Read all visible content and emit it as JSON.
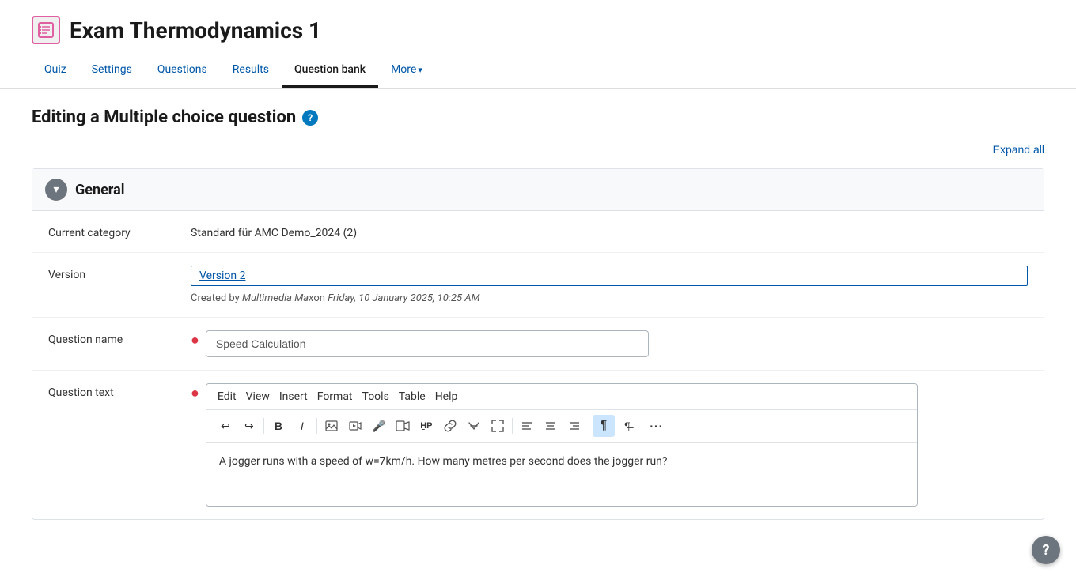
{
  "header": {
    "icon_label": "quiz-icon",
    "title": "Exam Thermodynamics 1",
    "nav_tabs": [
      {
        "id": "quiz",
        "label": "Quiz",
        "active": false
      },
      {
        "id": "settings",
        "label": "Settings",
        "active": false
      },
      {
        "id": "questions",
        "label": "Questions",
        "active": false
      },
      {
        "id": "results",
        "label": "Results",
        "active": false
      },
      {
        "id": "question-bank",
        "label": "Question bank",
        "active": true
      },
      {
        "id": "more",
        "label": "More",
        "active": false,
        "has_arrow": true
      }
    ]
  },
  "page": {
    "editing_title": "Editing a Multiple choice question",
    "help_tooltip": "?",
    "expand_all_label": "Expand all"
  },
  "general_section": {
    "title": "General",
    "toggle_symbol": "˅",
    "fields": {
      "current_category": {
        "label": "Current category",
        "value": "Standard für AMC Demo_2024 (2)"
      },
      "version": {
        "label": "Version",
        "link_text": "Version 2",
        "created_by_text": "Created by ",
        "author": "Multimedia Max",
        "date_prefix": "on ",
        "date": "Friday, 10 January 2025, 10:25 AM"
      },
      "question_name": {
        "label": "Question name",
        "value": "Speed Calculation",
        "placeholder": "Speed Calculation",
        "required": true
      },
      "question_text": {
        "label": "Question text",
        "required": true,
        "editor": {
          "menu_items": [
            "Edit",
            "View",
            "Insert",
            "Format",
            "Tools",
            "Table",
            "Help"
          ],
          "content": "A jogger runs with a speed of w=7km/h. How many metres per second does the jogger run?"
        }
      }
    }
  },
  "help_button": {
    "label": "?"
  },
  "toolbar_icons": {
    "undo": "↩",
    "redo": "↪",
    "bold": "B",
    "italic": "I",
    "image": "🖼",
    "video": "▶",
    "audio": "🎤",
    "media": "📹",
    "h_p": "H̱P",
    "link": "🔗",
    "special": "✂",
    "fullscreen": "⤢",
    "align_left": "≡",
    "align_center": "≡",
    "align_right": "≡",
    "paragraph": "¶",
    "pilcrow2": "¶",
    "more": "···"
  }
}
